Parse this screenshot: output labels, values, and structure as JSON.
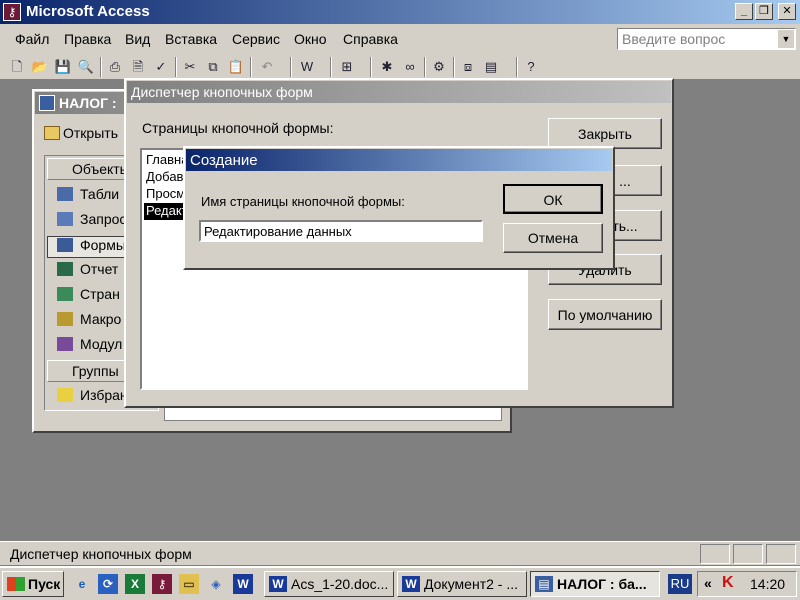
{
  "app": {
    "title": "Microsoft Access",
    "icon": "access-key-icon"
  },
  "menu": {
    "items": [
      "Файл",
      "Правка",
      "Вид",
      "Вставка",
      "Сервис",
      "Окно",
      "Справка"
    ],
    "help_placeholder": "Введите вопрос"
  },
  "db_window": {
    "title": "НАЛОГ :",
    "open_label": "Открыть",
    "objects_header": "Объекты",
    "groups_header": "Группы",
    "objects": [
      "Табли",
      "Запрос",
      "Формы",
      "Отчет",
      "Стран",
      "Макро",
      "Модул"
    ],
    "selected_object": "Формы",
    "favorites": "Избран"
  },
  "switchboard": {
    "title": "Диспетчер кнопочных форм",
    "pages_label": "Страницы кнопочной формы:",
    "pages": [
      "Главна",
      "Добавл",
      "Просмо",
      "Редакт"
    ],
    "selected_page": "Редакт",
    "buttons": {
      "close": "Закрыть",
      "new": "...",
      "edit": "ть...",
      "delete": "Удалить",
      "default": "По умолчанию"
    }
  },
  "create_dialog": {
    "title": "Создание",
    "label": "Имя страницы кнопочной формы:",
    "value": "Редактирование данных",
    "ok": "ОК",
    "cancel": "Отмена"
  },
  "status": {
    "text": "Диспетчер кнопочных форм"
  },
  "taskbar": {
    "start": "Пуск",
    "tasks": [
      "Acs_1-20.doc...",
      "Документ2 - ...",
      "НАЛОГ : ба..."
    ],
    "active_task": "НАЛОГ : ба...",
    "lang": "RU",
    "chevron": "«",
    "clock": "14:20"
  },
  "colors": {
    "active_title": "#0a246a",
    "inactive_title": "#808080",
    "face": "#d4d0c8",
    "desktop": "#808080"
  }
}
